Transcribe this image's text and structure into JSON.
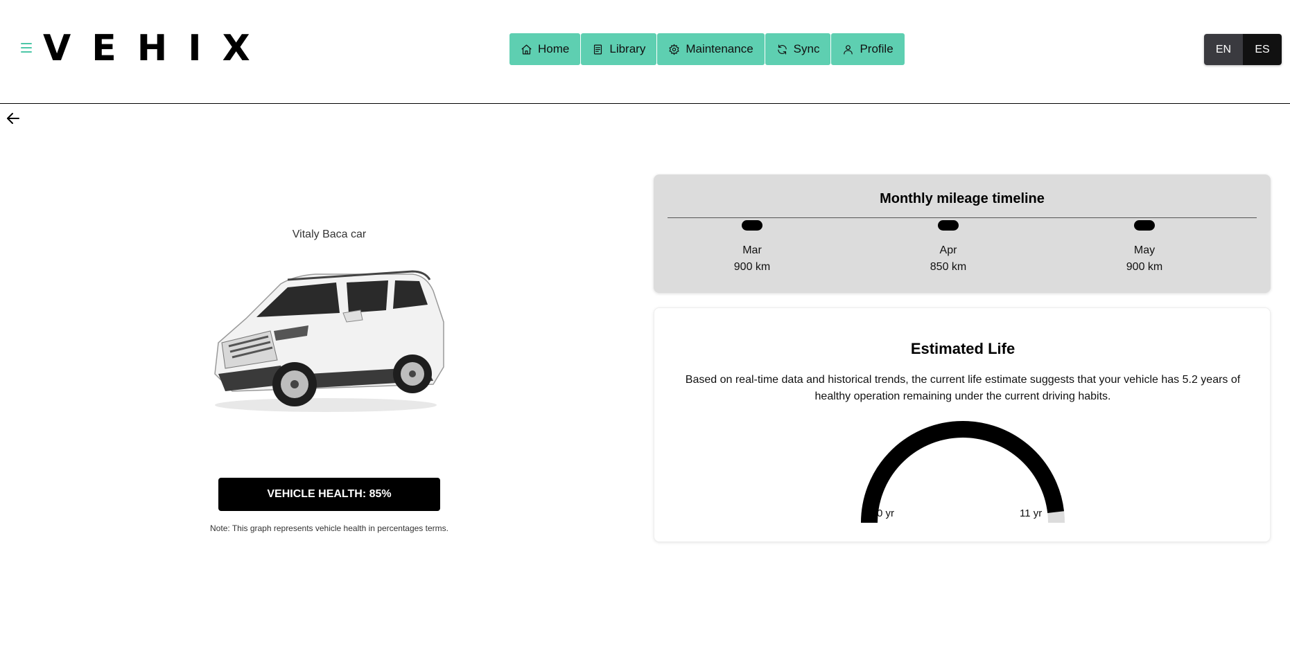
{
  "app": {
    "logo": "VEHIX"
  },
  "nav": [
    {
      "label": "Home",
      "icon": "home-icon"
    },
    {
      "label": "Library",
      "icon": "book-icon"
    },
    {
      "label": "Maintenance",
      "icon": "gear-icon"
    },
    {
      "label": "Sync",
      "icon": "sync-icon"
    },
    {
      "label": "Profile",
      "icon": "user-icon"
    }
  ],
  "language": {
    "options": [
      "EN",
      "ES"
    ],
    "selected": "ES"
  },
  "vehicle": {
    "title": "Vitaly Baca car",
    "health_label": "VEHICLE HEALTH: 85%",
    "health_percent": 85,
    "note": "Note: This graph represents vehicle health in percentages terms."
  },
  "mileage": {
    "title": "Monthly mileage timeline",
    "entries": [
      {
        "month": "Mar",
        "km": "900 km"
      },
      {
        "month": "Apr",
        "km": "850 km"
      },
      {
        "month": "May",
        "km": "900 km"
      }
    ]
  },
  "life": {
    "title": "Estimated Life",
    "description": "Based on real-time data and historical trends, the current life estimate suggests that your vehicle has 5.2 years of healthy operation remaining under the current driving habits.",
    "gauge": {
      "min_label": "0 yr",
      "max_label": "11 yr",
      "min": 0,
      "max": 11,
      "value": 10.6
    }
  },
  "colors": {
    "accent": "#5ecfb1",
    "dark": "#000000",
    "card_gray": "#dcdcdc"
  }
}
